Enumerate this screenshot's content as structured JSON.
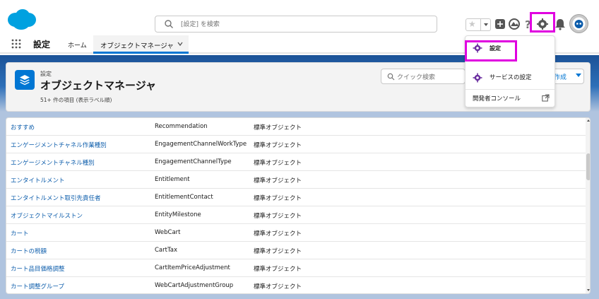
{
  "header": {
    "search_placeholder": "[設定] を検索"
  },
  "app_nav": {
    "app_name": "設定",
    "home": "ホーム",
    "active_tab": "オブジェクトマネージャ"
  },
  "object_manager": {
    "eyebrow": "設定",
    "title": "オブジェクトマネージャ",
    "item_count": "51+ 件の項目 (表示ラベル順)",
    "quick_find_placeholder": "クイック検索",
    "create_label": "作成"
  },
  "setup_menu": {
    "items": [
      {
        "label": "設定"
      },
      {
        "label": "サービスの設定"
      },
      {
        "label": "開発者コンソール"
      }
    ]
  },
  "table": {
    "rows": [
      {
        "label": "おすすめ",
        "api_name": "Recommendation",
        "type": "標準オブジェクト"
      },
      {
        "label": "エンゲージメントチャネル作業種別",
        "api_name": "EngagementChannelWorkType",
        "type": "標準オブジェクト"
      },
      {
        "label": "エンゲージメントチャネル種別",
        "api_name": "EngagementChannelType",
        "type": "標準オブジェクト"
      },
      {
        "label": "エンタイトルメント",
        "api_name": "Entitlement",
        "type": "標準オブジェクト"
      },
      {
        "label": "エンタイトルメント取引先責任者",
        "api_name": "EntitlementContact",
        "type": "標準オブジェクト"
      },
      {
        "label": "オブジェクトマイルストン",
        "api_name": "EntityMilestone",
        "type": "標準オブジェクト"
      },
      {
        "label": "カート",
        "api_name": "WebCart",
        "type": "標準オブジェクト"
      },
      {
        "label": "カートの税額",
        "api_name": "CartTax",
        "type": "標準オブジェクト"
      },
      {
        "label": "カート品目価格調整",
        "api_name": "CartItemPriceAdjustment",
        "type": "標準オブジェクト"
      },
      {
        "label": "カート調整グループ",
        "api_name": "WebCartAdjustmentGroup",
        "type": "標準オブジェクト"
      }
    ]
  },
  "colors": {
    "brand": "#00a1e0",
    "link": "#0b5cab",
    "highlight": "#e000e0",
    "gear": "#6b2fa0"
  }
}
